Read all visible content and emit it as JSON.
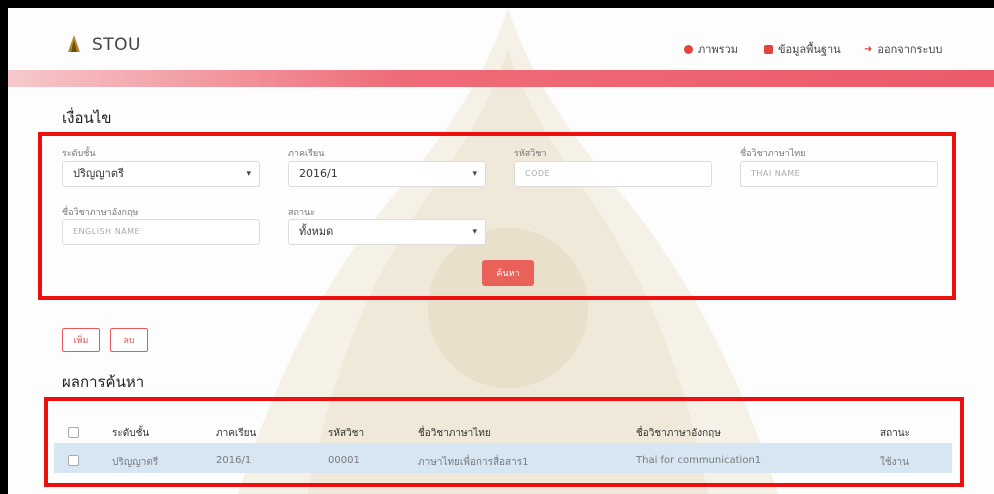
{
  "header": {
    "brand": "STOU",
    "nav": [
      {
        "label": "ภาพรวม",
        "icon": "home-icon",
        "color": "#e0453b"
      },
      {
        "label": "ข้อมูลพื้นฐาน",
        "icon": "database-icon",
        "color": "#e0453b"
      },
      {
        "label": "ออกจากระบบ",
        "icon": "logout-icon",
        "color": "#e0453b"
      }
    ]
  },
  "filter": {
    "title": "เงื่อนไข",
    "level": {
      "label": "ระดับชั้น",
      "value": "ปริญญาตรี"
    },
    "semester": {
      "label": "ภาคเรียน",
      "value": "2016/1"
    },
    "code": {
      "label": "รหัสวิชา",
      "placeholder": "CODE"
    },
    "thai_name": {
      "label": "ชื่อวิชาภาษาไทย",
      "placeholder": "THAI NAME"
    },
    "english_name": {
      "label": "ชื่อวิชาภาษาอังกฤษ",
      "placeholder": "ENGLISH NAME"
    },
    "status": {
      "label": "สถานะ",
      "value": "ทั้งหมด"
    },
    "search_button": "ค้นหา"
  },
  "actions": {
    "add": "เพิ่ม",
    "delete": "ลบ"
  },
  "results": {
    "title": "ผลการค้นหา",
    "columns": [
      "ระดับชั้น",
      "ภาคเรียน",
      "รหัสวิชา",
      "ชื่อวิชาภาษาไทย",
      "ชื่อวิชาภาษาอังกฤษ",
      "สถานะ"
    ],
    "rows": [
      [
        "ปริญญาตรี",
        "2016/1",
        "00001",
        "ภาษาไทยเพื่อการสื่อสาร1",
        "Thai for communication1",
        "ใช้งาน"
      ]
    ]
  },
  "colors": {
    "accent": "#ec5a6a",
    "highlight": "#ee0f0f",
    "row_selected": "#d6e6f2"
  }
}
